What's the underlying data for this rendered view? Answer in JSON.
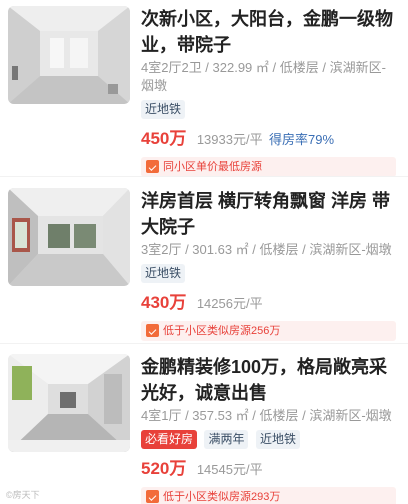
{
  "listings": [
    {
      "title": "次新小区，大阳台，金鹏一级物业，带院子",
      "meta": "4室2厅2卫 / 322.99 ㎡ / 低楼层 / 滨湖新区-烟墩",
      "tags": [
        "近地铁"
      ],
      "hot_tag": "",
      "price": "450万",
      "unit_price": "13933元/平",
      "rate": "得房率79%",
      "promo": "同小区单价最低房源"
    },
    {
      "title": "洋房首层 横厅转角飘窗 洋房 带大院子",
      "meta": "3室2厅 / 301.63 ㎡ / 低楼层 / 滨湖新区-烟墩",
      "tags": [
        "近地铁"
      ],
      "hot_tag": "",
      "price": "430万",
      "unit_price": "14256元/平",
      "rate": "",
      "promo": "低于小区类似房源256万"
    },
    {
      "title": "金鹏精装修100万，格局敞亮采光好，诚意出售",
      "meta": "4室1厅 / 357.53 ㎡ / 低楼层 / 滨湖新区-烟墩",
      "tags": [
        "满两年",
        "近地铁"
      ],
      "hot_tag": "必看好房",
      "price": "520万",
      "unit_price": "14545元/平",
      "rate": "",
      "promo": "低于小区类似房源293万"
    }
  ],
  "watermark": "©房天下"
}
